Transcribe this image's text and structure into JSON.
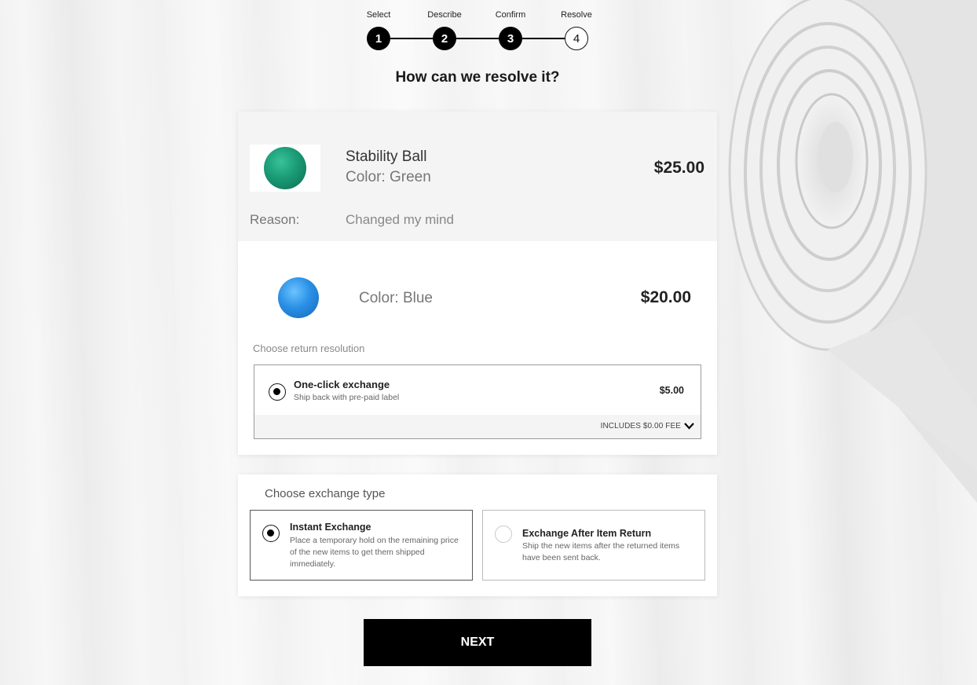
{
  "stepper": {
    "steps": [
      {
        "label": "Select",
        "number": "1",
        "done": true
      },
      {
        "label": "Describe",
        "number": "2",
        "done": true
      },
      {
        "label": "Confirm",
        "number": "3",
        "done": true
      },
      {
        "label": "Resolve",
        "number": "4",
        "done": false
      }
    ]
  },
  "page": {
    "heading": "How can we resolve it?"
  },
  "original_item": {
    "name": "Stability Ball",
    "color": "Color: Green",
    "price": "$25.00",
    "reason_label": "Reason:",
    "reason_value": "Changed my mind",
    "image_color": "#1a9a75"
  },
  "new_item": {
    "color": "Color: Blue",
    "price": "$20.00",
    "image_color": "#2a90e6"
  },
  "resolution": {
    "label": "Choose return resolution",
    "option": {
      "title": "One-click exchange",
      "subtitle": "Ship back with pre-paid label",
      "price": "$5.00",
      "fee_text": "INCLUDES $0.00 FEE",
      "selected": true
    }
  },
  "exchange_type": {
    "label": "Choose exchange type",
    "options": [
      {
        "title": "Instant Exchange",
        "description": "Place a temporary hold on the remaining price of the new items to get them shipped immediately.",
        "selected": true
      },
      {
        "title": "Exchange After Item Return",
        "description": "Ship the new items after the returned items have been sent back.",
        "selected": false
      }
    ]
  },
  "actions": {
    "next_label": "NEXT"
  }
}
